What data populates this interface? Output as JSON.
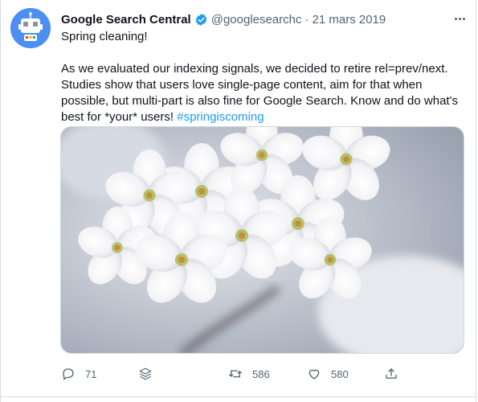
{
  "tweet": {
    "display_name": "Google Search Central",
    "handle": "@googlesearchc",
    "separator": "·",
    "date": "21 mars 2019",
    "text": {
      "line1": "Spring cleaning!",
      "line2": "As we evaluated our indexing signals, we decided to retire rel=prev/next.",
      "line3": "Studies show that users love single-page content, aim for that when",
      "line4": "possible, but multi-part is also fine for Google Search. Know and do what's",
      "line5_prefix": "best for *your* users! ",
      "hashtag": "#springiscoming"
    },
    "icons": {
      "avatar": "robot-avatar-icon",
      "verified": "verified-badge-icon",
      "more": "more-options-icon",
      "media": "cherry-blossom-photo"
    }
  },
  "actions": {
    "reply": {
      "icon": "reply-icon",
      "count": "71"
    },
    "stack": {
      "icon": "stack-icon"
    },
    "retweet": {
      "icon": "retweet-icon",
      "count": "586"
    },
    "like": {
      "icon": "heart-icon",
      "count": "580"
    },
    "share": {
      "icon": "share-icon"
    }
  },
  "colors": {
    "accent": "#1d9bf0",
    "avatar_bg": "#4d8ff1",
    "secondary_text": "#536471"
  }
}
